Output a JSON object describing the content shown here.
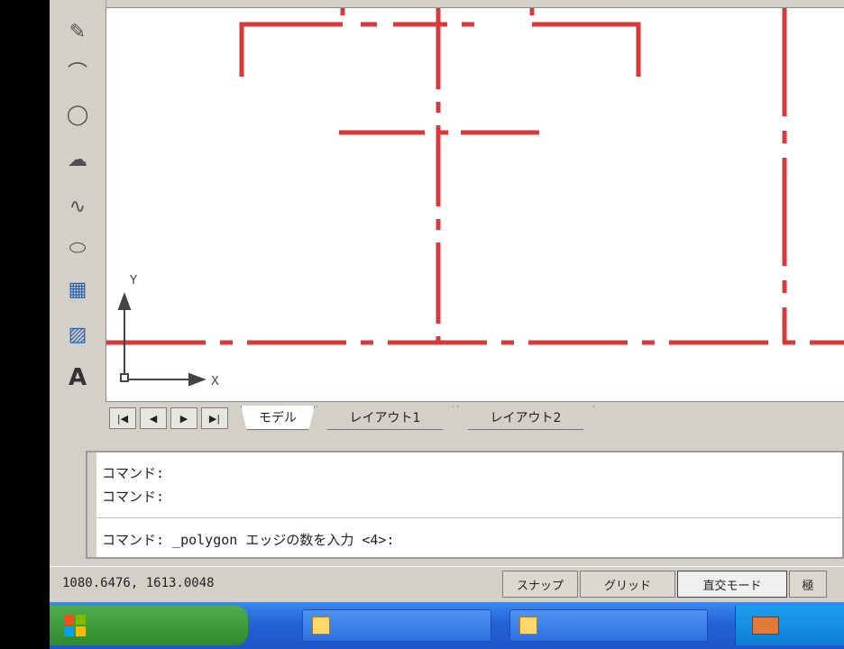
{
  "toolbar": {
    "tools": [
      {
        "icon": "pencil-icon",
        "glyph": "✎"
      },
      {
        "icon": "arc-icon",
        "glyph": "⌒"
      },
      {
        "icon": "circle-icon",
        "glyph": "◯"
      },
      {
        "icon": "revision-cloud-icon",
        "glyph": "☁"
      },
      {
        "icon": "spline-icon",
        "glyph": "∿"
      },
      {
        "icon": "ellipse-icon",
        "glyph": "⬭"
      },
      {
        "icon": "insert-block-icon",
        "glyph": "▦"
      },
      {
        "icon": "hatch-icon",
        "glyph": "▨"
      },
      {
        "icon": "multiline-text-icon",
        "glyph": "A"
      }
    ]
  },
  "ucs": {
    "y_label": "Y",
    "x_label": "X"
  },
  "layout_tabs": {
    "nav": [
      "|◀",
      "◀",
      "▶",
      "▶|"
    ],
    "tabs": [
      "モデル",
      "レイアウト1",
      "レイアウト2"
    ]
  },
  "command": {
    "lines": [
      "コマンド:",
      "コマンド:"
    ],
    "current": "コマンド: _polygon エッジの数を入力 <4>:"
  },
  "status": {
    "coords": "1080.6476, 1613.0048",
    "buttons": [
      "スナップ",
      "グリッド",
      "直交モード",
      "極"
    ]
  },
  "colors": {
    "centerline": "#d8393a",
    "canvas": "#ffffff",
    "chrome": "#d4d0c8"
  }
}
